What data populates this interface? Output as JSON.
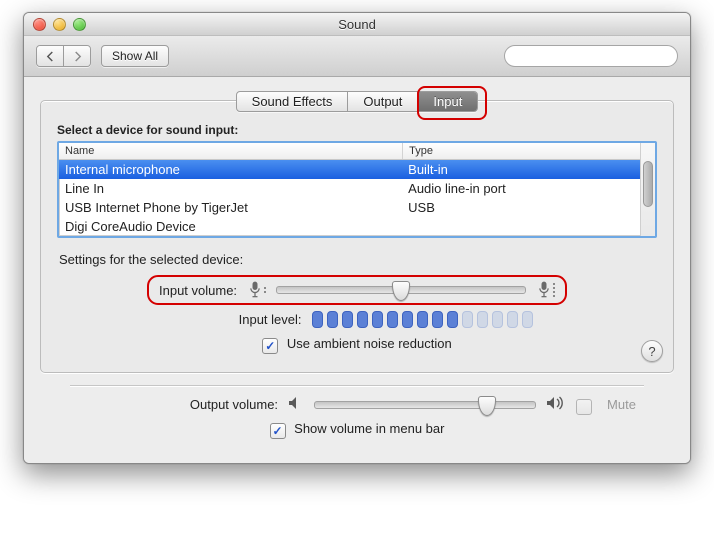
{
  "window": {
    "title": "Sound"
  },
  "toolbar": {
    "show_all_label": "Show All",
    "search_placeholder": ""
  },
  "tabs": {
    "items": [
      "Sound Effects",
      "Output",
      "Input"
    ],
    "active_index": 2
  },
  "device_table": {
    "heading": "Select a device for sound input:",
    "columns": {
      "name": "Name",
      "type": "Type"
    },
    "rows": [
      {
        "name": "Internal microphone",
        "type": "Built-in",
        "selected": true
      },
      {
        "name": "Line In",
        "type": "Audio line-in port",
        "selected": false
      },
      {
        "name": "USB Internet Phone by TigerJet",
        "type": "USB",
        "selected": false
      },
      {
        "name": "Digi CoreAudio Device",
        "type": "",
        "selected": false
      }
    ]
  },
  "settings": {
    "heading": "Settings for the selected device:",
    "input_volume_label": "Input volume:",
    "input_volume_percent": 50,
    "input_level_label": "Input level:",
    "input_level_active_segments": 10,
    "input_level_total_segments": 15,
    "ambient_noise_label": "Use ambient noise reduction",
    "ambient_noise_checked": true
  },
  "output": {
    "label": "Output volume:",
    "volume_percent": 78,
    "mute_label": "Mute",
    "mute_checked": false,
    "mute_enabled": false,
    "show_volume_menu_label": "Show volume in menu bar",
    "show_volume_menu_checked": true
  },
  "help": {
    "label": "?"
  },
  "highlights": {
    "tab_input": true,
    "input_volume_row": true
  }
}
